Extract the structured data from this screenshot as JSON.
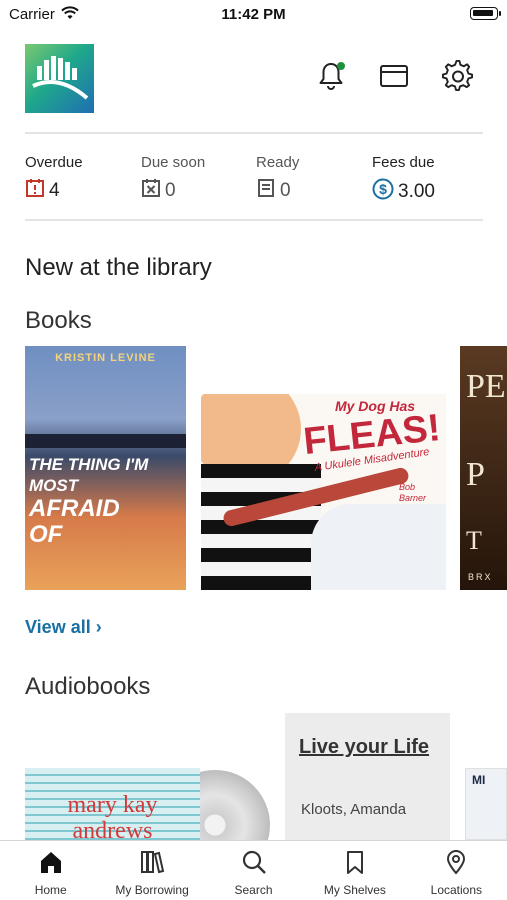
{
  "status_bar": {
    "carrier": "Carrier",
    "time": "11:42 PM"
  },
  "header": {
    "has_notification": true
  },
  "stats": [
    {
      "label": "Overdue",
      "value": "4",
      "icon": "overdue-alert-icon",
      "color": "#c0392b"
    },
    {
      "label": "Due soon",
      "value": "0",
      "icon": "due-soon-icon",
      "color": "#555555"
    },
    {
      "label": "Ready",
      "value": "0",
      "icon": "ready-icon",
      "color": "#555555"
    },
    {
      "label": "Fees due",
      "value": "3.00",
      "icon": "fees-dollar-icon",
      "color": "#1a6fa3"
    }
  ],
  "main": {
    "section_title": "New at the library",
    "books": {
      "title": "Books",
      "view_all": "View all",
      "covers": [
        {
          "author": "KRISTIN LEVINE",
          "title_line1": "THE THING I'M MOST",
          "title_line2": "AFRAID",
          "title_line3": "OF"
        },
        {
          "title_line1": "My Dog Has",
          "title_line2": "FLEAS!",
          "subtitle": "A Ukulele Misadventure",
          "author": "Bob Barner"
        },
        {
          "text1": "PE",
          "text2": "P",
          "text3": "T",
          "text4": "BRX"
        }
      ]
    },
    "audiobooks": {
      "title": "Audiobooks",
      "cover1_text": "mary kay andrews",
      "card": {
        "title": "Live your Life",
        "author": "Kloots, Amanda"
      },
      "cover3_text": "MI"
    }
  },
  "tabs": [
    {
      "label": "Home",
      "icon": "home-icon"
    },
    {
      "label": "My Borrowing",
      "icon": "books-icon"
    },
    {
      "label": "Search",
      "icon": "search-icon"
    },
    {
      "label": "My Shelves",
      "icon": "bookmark-icon"
    },
    {
      "label": "Locations",
      "icon": "location-pin-icon"
    }
  ],
  "colors": {
    "accent": "#1a6fa3",
    "overdue": "#c0392b",
    "notification_dot": "#1e8f3a"
  }
}
